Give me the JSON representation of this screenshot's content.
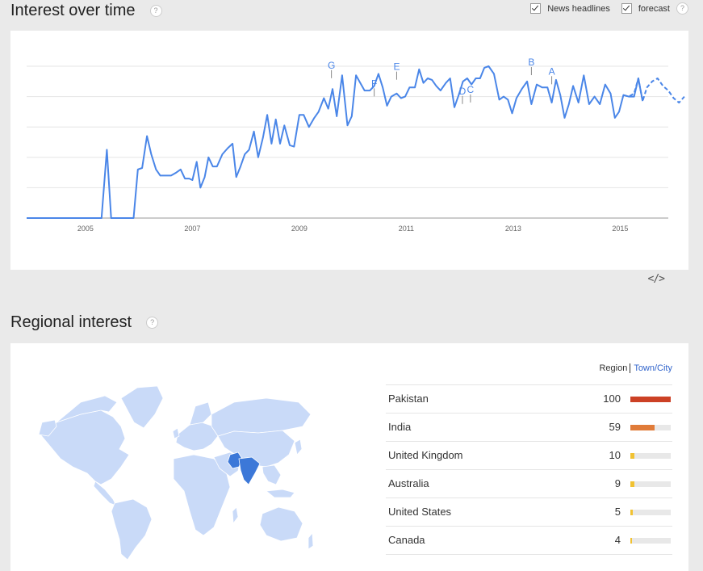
{
  "interest_section": {
    "title": "Interest over time",
    "help": "?",
    "options": [
      {
        "label": "News headlines",
        "checked": true
      },
      {
        "label": "forecast",
        "checked": true
      }
    ],
    "embed_label": "</>"
  },
  "chart_data": {
    "type": "line",
    "line_color": "#4a86e8",
    "x_ticks": [
      "2005",
      "2007",
      "2009",
      "2011",
      "2013",
      "2015"
    ],
    "xlim": [
      2004.0,
      2016.0
    ],
    "ylim": [
      0,
      100
    ],
    "grid": "horizontal",
    "series": [
      {
        "values": [
          [
            2004.0,
            0
          ],
          [
            2004.5,
            0
          ],
          [
            2005.0,
            0
          ],
          [
            2005.4,
            0
          ],
          [
            2005.5,
            45
          ],
          [
            2005.58,
            0
          ],
          [
            2005.7,
            0
          ],
          [
            2006.0,
            0
          ],
          [
            2006.08,
            32
          ],
          [
            2006.16,
            33
          ],
          [
            2006.25,
            54
          ],
          [
            2006.33,
            42
          ],
          [
            2006.42,
            32
          ],
          [
            2006.5,
            28
          ],
          [
            2006.6,
            28
          ],
          [
            2006.7,
            28
          ],
          [
            2006.8,
            30
          ],
          [
            2006.88,
            32
          ],
          [
            2006.96,
            26
          ],
          [
            2007.04,
            26
          ],
          [
            2007.1,
            25
          ],
          [
            2007.18,
            37
          ],
          [
            2007.25,
            20
          ],
          [
            2007.33,
            27
          ],
          [
            2007.4,
            40
          ],
          [
            2007.48,
            34
          ],
          [
            2007.56,
            34
          ],
          [
            2007.66,
            42
          ],
          [
            2007.76,
            46
          ],
          [
            2007.85,
            49
          ],
          [
            2007.92,
            27
          ],
          [
            2008.0,
            34
          ],
          [
            2008.08,
            42
          ],
          [
            2008.16,
            45
          ],
          [
            2008.25,
            57
          ],
          [
            2008.33,
            40
          ],
          [
            2008.42,
            53
          ],
          [
            2008.5,
            68
          ],
          [
            2008.58,
            49
          ],
          [
            2008.66,
            65
          ],
          [
            2008.74,
            49
          ],
          [
            2008.82,
            61
          ],
          [
            2008.92,
            48
          ],
          [
            2009.0,
            47
          ],
          [
            2009.1,
            68
          ],
          [
            2009.18,
            68
          ],
          [
            2009.28,
            60
          ],
          [
            2009.38,
            66
          ],
          [
            2009.46,
            70
          ],
          [
            2009.56,
            79
          ],
          [
            2009.64,
            72
          ],
          [
            2009.72,
            85
          ],
          [
            2009.8,
            67
          ],
          [
            2009.9,
            94
          ],
          [
            2010.0,
            61
          ],
          [
            2010.08,
            67
          ],
          [
            2010.16,
            94
          ],
          [
            2010.24,
            89
          ],
          [
            2010.32,
            84
          ],
          [
            2010.42,
            84
          ],
          [
            2010.5,
            87
          ],
          [
            2010.58,
            95
          ],
          [
            2010.66,
            86
          ],
          [
            2010.74,
            74
          ],
          [
            2010.82,
            80
          ],
          [
            2010.92,
            82
          ],
          [
            2011.0,
            79
          ],
          [
            2011.08,
            80
          ],
          [
            2011.16,
            86
          ],
          [
            2011.26,
            86
          ],
          [
            2011.34,
            98
          ],
          [
            2011.42,
            89
          ],
          [
            2011.5,
            92
          ],
          [
            2011.58,
            91
          ],
          [
            2011.66,
            87
          ],
          [
            2011.74,
            84
          ],
          [
            2011.84,
            89
          ],
          [
            2011.92,
            92
          ],
          [
            2012.0,
            73
          ],
          [
            2012.08,
            81
          ],
          [
            2012.16,
            90
          ],
          [
            2012.24,
            92
          ],
          [
            2012.32,
            88
          ],
          [
            2012.4,
            92
          ],
          [
            2012.48,
            92
          ],
          [
            2012.56,
            99
          ],
          [
            2012.64,
            100
          ],
          [
            2012.74,
            95
          ],
          [
            2012.84,
            78
          ],
          [
            2012.92,
            80
          ],
          [
            2013.0,
            78
          ],
          [
            2013.08,
            69
          ],
          [
            2013.16,
            79
          ],
          [
            2013.26,
            85
          ],
          [
            2013.36,
            90
          ],
          [
            2013.44,
            75
          ],
          [
            2013.54,
            88
          ],
          [
            2013.64,
            86
          ],
          [
            2013.74,
            86
          ],
          [
            2013.82,
            76
          ],
          [
            2013.9,
            91
          ],
          [
            2013.98,
            81
          ],
          [
            2014.06,
            66
          ],
          [
            2014.14,
            75
          ],
          [
            2014.22,
            87
          ],
          [
            2014.32,
            76
          ],
          [
            2014.42,
            94
          ],
          [
            2014.52,
            75
          ],
          [
            2014.62,
            80
          ],
          [
            2014.72,
            75
          ],
          [
            2014.82,
            88
          ],
          [
            2014.92,
            82
          ],
          [
            2015.0,
            66
          ],
          [
            2015.08,
            70
          ],
          [
            2015.16,
            81
          ],
          [
            2015.26,
            80
          ],
          [
            2015.36,
            80
          ],
          [
            2015.44,
            92
          ],
          [
            2015.52,
            77
          ]
        ]
      },
      {
        "style": "dashed",
        "values": [
          [
            2015.16,
            81
          ],
          [
            2015.26,
            80
          ],
          [
            2015.36,
            82
          ],
          [
            2015.44,
            92
          ],
          [
            2015.52,
            77
          ],
          [
            2015.6,
            86
          ],
          [
            2015.7,
            90
          ],
          [
            2015.8,
            92
          ],
          [
            2015.9,
            87
          ],
          [
            2016.0,
            84
          ],
          [
            2016.1,
            79
          ],
          [
            2016.2,
            76
          ],
          [
            2016.3,
            80
          ]
        ]
      }
    ],
    "annotations": [
      {
        "label": "G",
        "x": 2009.7,
        "y": 90
      },
      {
        "label": "F",
        "x": 2010.5,
        "y": 78
      },
      {
        "label": "E",
        "x": 2010.92,
        "y": 89
      },
      {
        "label": "D",
        "x": 2012.15,
        "y": 73
      },
      {
        "label": "C",
        "x": 2012.3,
        "y": 74
      },
      {
        "label": "B",
        "x": 2013.44,
        "y": 92
      },
      {
        "label": "A",
        "x": 2013.82,
        "y": 86
      }
    ]
  },
  "regional_section": {
    "title": "Regional interest",
    "help": "?",
    "tabs": {
      "region": "Region",
      "city": "Town/City"
    },
    "regions": [
      {
        "name": "Pakistan",
        "value": "100",
        "pct": 100,
        "color": "#cc4125"
      },
      {
        "name": "India",
        "value": "59",
        "pct": 59,
        "color": "#e07b39"
      },
      {
        "name": "United Kingdom",
        "value": "10",
        "pct": 10,
        "color": "#f1c232"
      },
      {
        "name": "Australia",
        "value": "9",
        "pct": 9,
        "color": "#f1c232"
      },
      {
        "name": "United States",
        "value": "5",
        "pct": 5,
        "color": "#f1c232"
      },
      {
        "name": "Canada",
        "value": "4",
        "pct": 4,
        "color": "#f1c232"
      }
    ]
  },
  "map_colors": {
    "land": "#c9daf8",
    "highlight": "#3c78d8",
    "border": "#ffffff"
  }
}
